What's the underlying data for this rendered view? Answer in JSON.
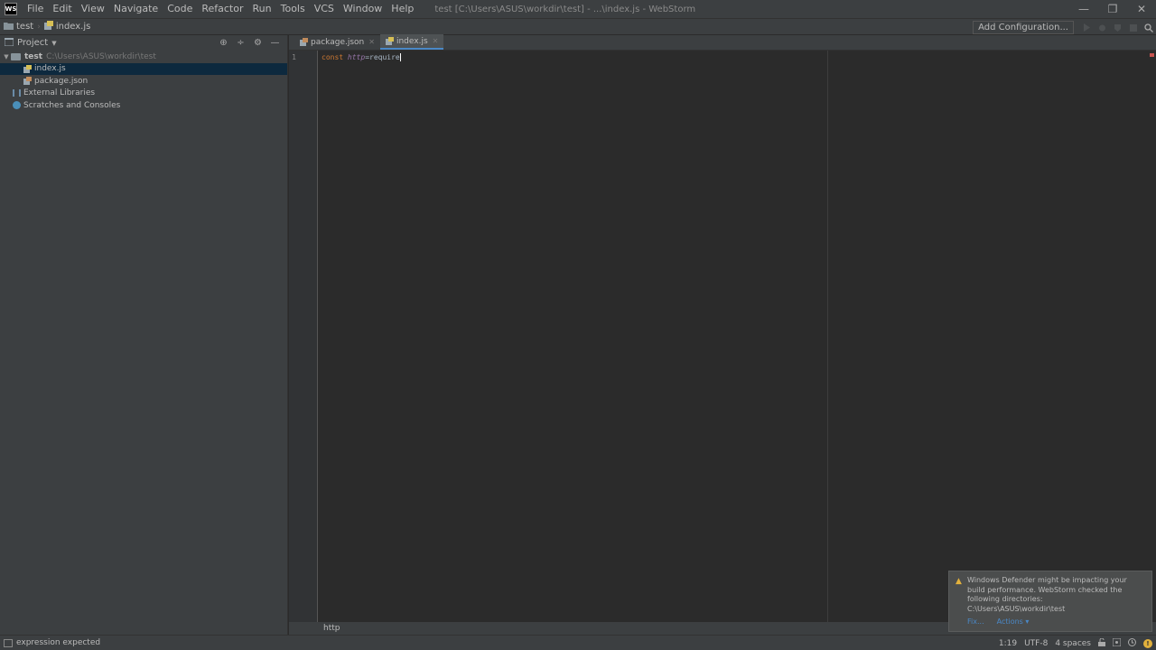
{
  "window": {
    "title": "test [C:\\Users\\ASUS\\workdir\\test] - ...\\index.js - WebStorm",
    "logo": "WS",
    "minimize_glyph": "—",
    "restore_glyph": "❐",
    "close_glyph": "✕"
  },
  "menu": [
    "File",
    "Edit",
    "View",
    "Navigate",
    "Code",
    "Refactor",
    "Run",
    "Tools",
    "VCS",
    "Window",
    "Help"
  ],
  "navbar": {
    "crumbs": [
      {
        "label": "test",
        "icon": "folder-icon"
      },
      {
        "label": "index.js",
        "icon": "js-file-icon"
      }
    ],
    "add_configuration": "Add Configuration...",
    "icons": [
      "run-icon",
      "debug-icon",
      "coverage-icon",
      "stop-icon",
      "search-icon"
    ]
  },
  "project": {
    "title": "Project",
    "tree": [
      {
        "label": "test",
        "path": "C:\\Users\\ASUS\\workdir\\test",
        "type": "folder",
        "expanded": true
      },
      {
        "label": "index.js",
        "type": "js-file",
        "selected": true
      },
      {
        "label": "package.json",
        "type": "json-file"
      },
      {
        "label": "External Libraries",
        "type": "library"
      },
      {
        "label": "Scratches and Consoles",
        "type": "scratch"
      }
    ]
  },
  "editor": {
    "tabs": [
      {
        "label": "package.json",
        "active": false
      },
      {
        "label": "index.js",
        "active": true
      }
    ],
    "line_number": "1",
    "code": {
      "keyword": "const",
      "variable": "http",
      "rest": "=require"
    },
    "breadcrumb": "http"
  },
  "notification": {
    "message_lines": [
      "Windows Defender might be impacting your",
      "build performance. WebStorm checked the",
      "following directories:",
      "C:\\Users\\ASUS\\workdir\\test"
    ],
    "fix_label": "Fix...",
    "actions_label": "Actions ▾"
  },
  "status": {
    "message": "expression expected",
    "position": "1:19",
    "encoding": "UTF-8",
    "indent": "4 spaces",
    "event_count": "!"
  },
  "colors": {
    "accent": "#4a88c7",
    "keyword": "#cc7832",
    "variable": "#9876aa",
    "warning": "#e2b13c"
  }
}
